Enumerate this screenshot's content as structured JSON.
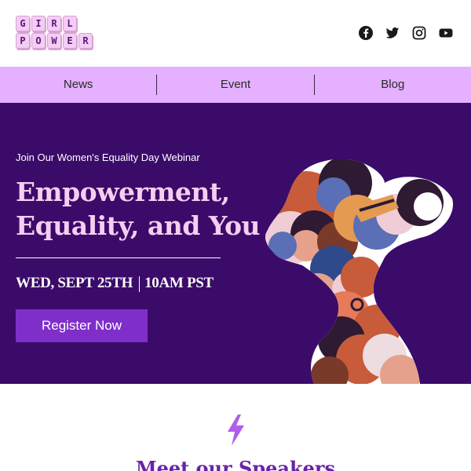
{
  "logo": {
    "row1": [
      "G",
      "I",
      "R",
      "L"
    ],
    "row2": [
      "P",
      "O",
      "W",
      "E",
      "R"
    ]
  },
  "social": [
    "facebook-icon",
    "twitter-icon",
    "instagram-icon",
    "youtube-icon"
  ],
  "nav": {
    "items": [
      "News",
      "Event",
      "Blog"
    ]
  },
  "hero": {
    "kicker": "Join Our Women's Equality Day Webinar",
    "headline_line1": "Empowerment,",
    "headline_line2": "Equality, and You",
    "date": "WED, SEPT 25TH",
    "time": "10AM PST",
    "register_label": "Register Now"
  },
  "speakers": {
    "title": "Meet our Speakers"
  },
  "colors": {
    "nav_bg": "#e4b0ff",
    "hero_bg": "#3b0b6a",
    "headline": "#f7cdf0",
    "button": "#7f2ec9",
    "accent": "#6b21a8",
    "bolt": "#b05de8"
  }
}
